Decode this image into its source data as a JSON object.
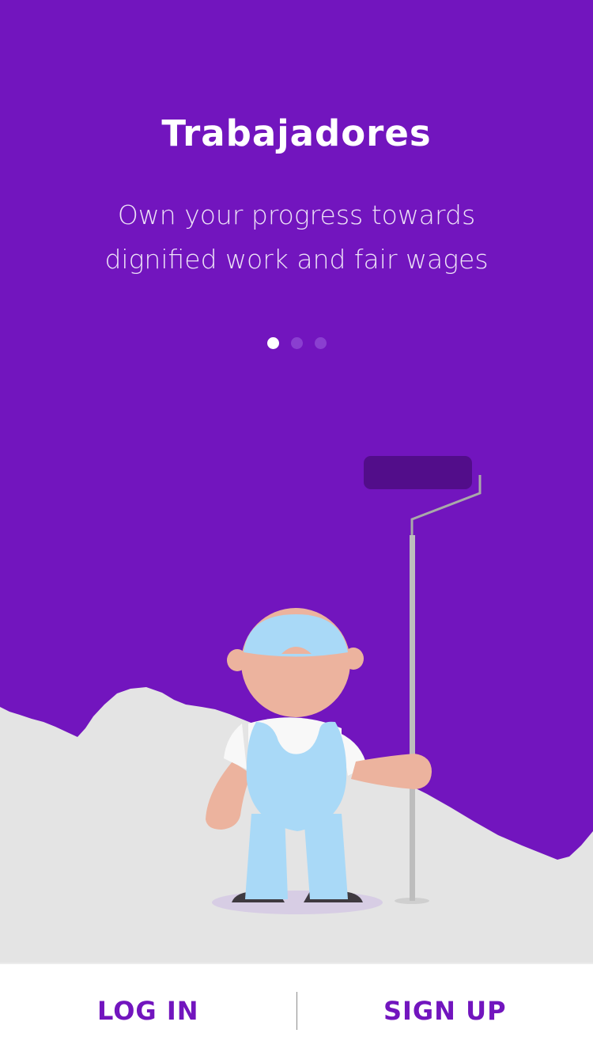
{
  "onboarding": {
    "title": "Trabajadores",
    "subtitle": "Own your progress towards dignified work and fair wages",
    "page_indicator": {
      "count": 3,
      "active_index": 0
    }
  },
  "illustration": {
    "subject": "painter-with-paint-roller",
    "icons": [
      "painter-figure",
      "paint-roller-icon"
    ]
  },
  "footer": {
    "login_label": "LOG IN",
    "signup_label": "SIGN UP"
  },
  "colors": {
    "brand_purple": "#7215be",
    "roller_dark": "#520d8a",
    "wall_grey": "#e4e4e4",
    "overalls_blue": "#a9d9f7",
    "skin": "#ecb39e",
    "button_text": "#7215be",
    "background_white": "#ffffff"
  }
}
